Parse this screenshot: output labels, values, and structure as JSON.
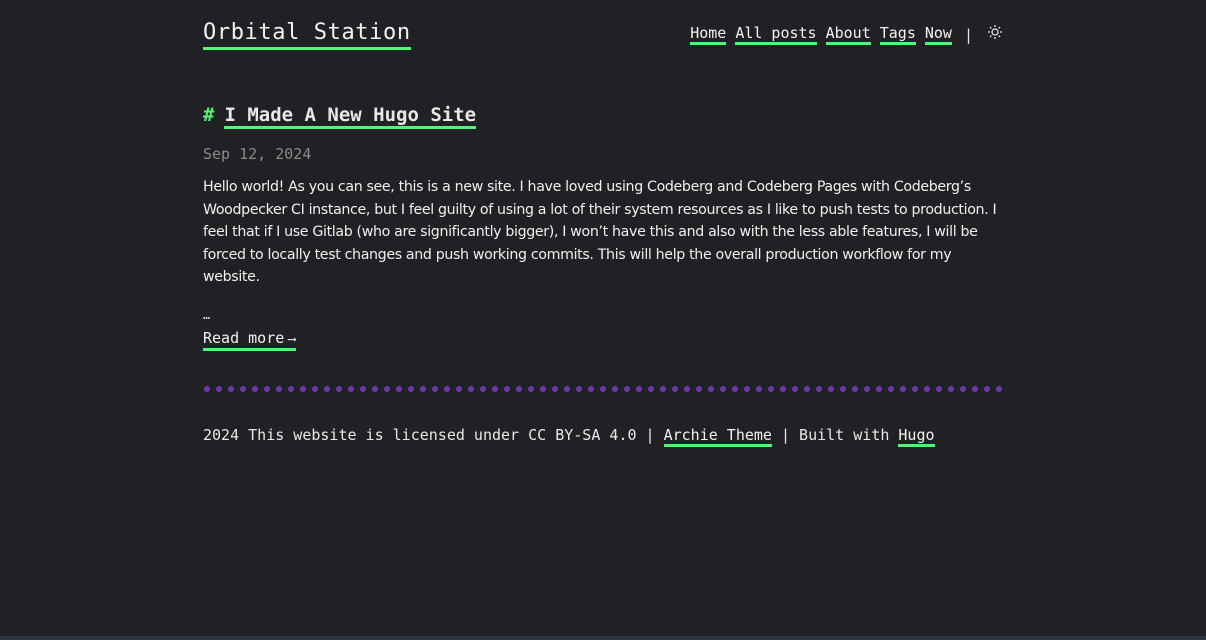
{
  "site": {
    "title": "Orbital Station"
  },
  "nav": {
    "items": [
      {
        "label": "Home"
      },
      {
        "label": "All posts"
      },
      {
        "label": "About"
      },
      {
        "label": "Tags"
      },
      {
        "label": "Now"
      }
    ],
    "separator": "|",
    "theme_toggle_icon": "sun-icon"
  },
  "post": {
    "hash": "#",
    "title": "I Made A New Hugo Site",
    "date": "Sep 12, 2024",
    "summary": "Hello world! As you can see, this is a new site. I have loved using Codeberg and Codeberg Pages with Codeberg’s Woodpecker CI instance, but I feel guilty of using a lot of their system resources as I like to push tests to production. I feel that if I use Gitlab (who are significantly bigger), I won’t have this and also with the less able features, I will be forced to locally test changes and push working commits. This will help the overall production workflow for my website.",
    "ellipsis": "…",
    "read_more_label": "Read more",
    "read_more_arrow": "⟶"
  },
  "footer": {
    "license_text": "2024 This website is licensed under CC BY-SA 4.0 | ",
    "theme_link": "Archie Theme",
    "mid_text": " | Built with ",
    "hugo_link": "Hugo"
  },
  "colors": {
    "background": "#202124",
    "accent": "#52f57a",
    "divider": "#6d37a8",
    "date": "#8a8a8a"
  }
}
